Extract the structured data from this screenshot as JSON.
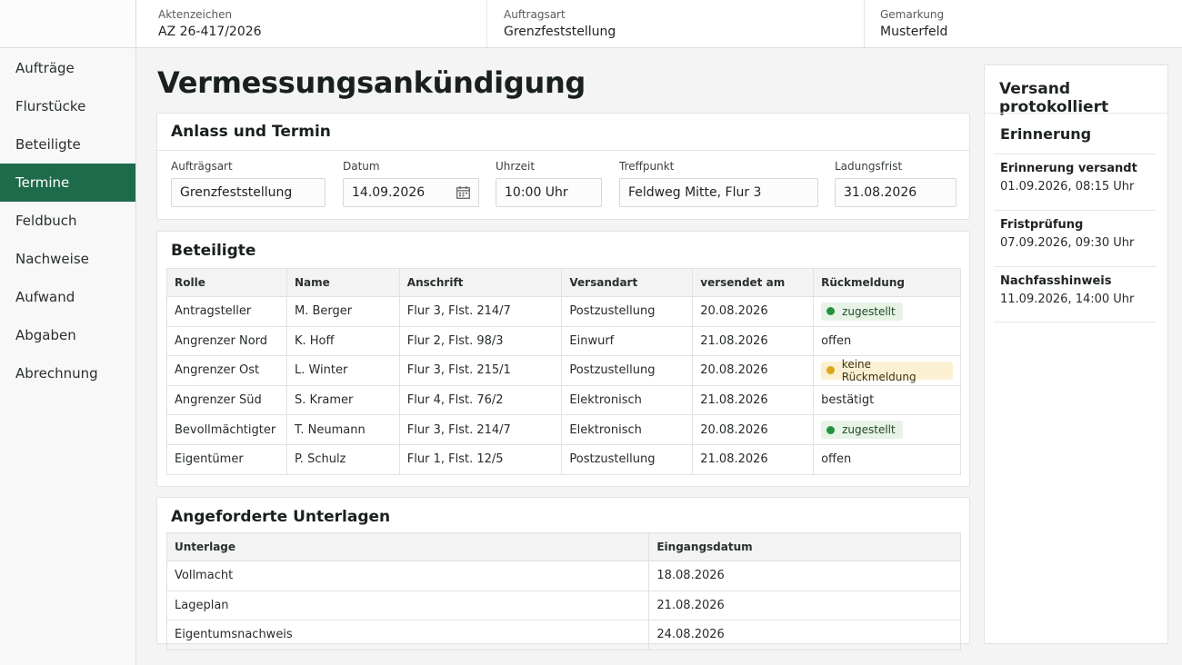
{
  "header": {
    "aktenzeichen_label": "Aktenzeichen",
    "aktenzeichen_value": "AZ 26-417/2026",
    "auftragsart_label": "Auftragsart",
    "auftragsart_value": "Grenzfeststellung",
    "gemarkung_label": "Gemarkung",
    "gemarkung_value": "Musterfeld"
  },
  "sidebar": {
    "items": [
      {
        "label": "Aufträge"
      },
      {
        "label": "Flurstücke"
      },
      {
        "label": "Beteiligte"
      },
      {
        "label": "Termine",
        "active": true
      },
      {
        "label": "Feldbuch"
      },
      {
        "label": "Nachweise"
      },
      {
        "label": "Aufwand"
      },
      {
        "label": "Abgaben"
      },
      {
        "label": "Abrechnung"
      }
    ]
  },
  "page": {
    "title": "Vermessungsankündigung"
  },
  "termin": {
    "title": "Anlass und Termin",
    "fields": {
      "auftragsart": {
        "label": "Aufträgsart",
        "value": "Grenzfeststellung"
      },
      "datum": {
        "label": "Datum",
        "value": "14.09.2026"
      },
      "uhrzeit": {
        "label": "Uhrzeit",
        "value": "10:00 Uhr"
      },
      "treffpunkt": {
        "label": "Treffpunkt",
        "value": "Feldweg Mitte, Flur 3"
      },
      "ladungsfrist": {
        "label": "Ladungsfrist",
        "value": "31.08.2026"
      }
    }
  },
  "beteiligte": {
    "title": "Beteiligte",
    "columns": [
      "Rolle",
      "Name",
      "Anschrift",
      "Versandart",
      "versendet am",
      "Rückmeldung"
    ],
    "rows": [
      {
        "rolle": "Antragsteller",
        "name": "M. Berger",
        "anschrift": "Flur 3, Flst. 214/7",
        "versandart": "Postzustellung",
        "versendet": "20.08.2026",
        "rueckmeldung": "zugestellt",
        "status": "green"
      },
      {
        "rolle": "Angrenzer Nord",
        "name": "K. Hoff",
        "anschrift": "Flur 2, Flst. 98/3",
        "versandart": "Einwurf",
        "versendet": "21.08.2026",
        "rueckmeldung": "offen",
        "status": "none"
      },
      {
        "rolle": "Angrenzer Ost",
        "name": "L. Winter",
        "anschrift": "Flur 3, Flst. 215/1",
        "versandart": "Postzustellung",
        "versendet": "20.08.2026",
        "rueckmeldung": "keine Rückmeldung",
        "status": "yellow"
      },
      {
        "rolle": "Angrenzer Süd",
        "name": "S. Kramer",
        "anschrift": "Flur 4, Flst. 76/2",
        "versandart": "Elektronisch",
        "versendet": "21.08.2026",
        "rueckmeldung": "bestätigt",
        "status": "none"
      },
      {
        "rolle": "Bevollmächtigter",
        "name": "T. Neumann",
        "anschrift": "Flur 3, Flst. 214/7",
        "versandart": "Elektronisch",
        "versendet": "20.08.2026",
        "rueckmeldung": "zugestellt",
        "status": "green"
      },
      {
        "rolle": "Eigentümer",
        "name": "P. Schulz",
        "anschrift": "Flur 1, Flst. 12/5",
        "versandart": "Postzustellung",
        "versendet": "21.08.2026",
        "rueckmeldung": "offen",
        "status": "none"
      }
    ]
  },
  "unterlagen": {
    "title": "Angeforderte Unterlagen",
    "columns": [
      "Unterlage",
      "Eingangsdatum"
    ],
    "rows": [
      {
        "unterlage": "Vollmacht",
        "datum": "18.08.2026"
      },
      {
        "unterlage": "Lageplan",
        "datum": "21.08.2026"
      },
      {
        "unterlage": "Eigentumsnachweis",
        "datum": "24.08.2026"
      }
    ]
  },
  "versand": {
    "title": "Versand protokolliert",
    "subtitle": "Erinnerung",
    "items": [
      {
        "title": "Erinnerung versandt",
        "time": "01.09.2026, 08:15 Uhr"
      },
      {
        "title": "Fristprüfung",
        "time": "07.09.2026, 09:30 Uhr"
      },
      {
        "title": "Nachfasshinweis",
        "time": "11.09.2026, 14:00 Uhr"
      }
    ]
  },
  "colors": {
    "accent": "#1e6b4b",
    "status_green": "#27923d",
    "status_yellow": "#d9a719"
  },
  "icons": {
    "datum_field": "calendar-icon"
  }
}
